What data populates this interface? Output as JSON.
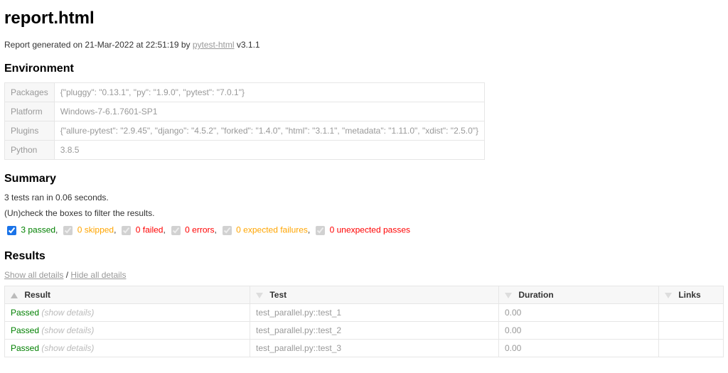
{
  "title": "report.html",
  "generated": {
    "prefix": "Report generated on ",
    "datetime": "21-Mar-2022 at 22:51:19",
    "by": " by ",
    "tool_link": "pytest-html",
    "version_suffix": " v3.1.1"
  },
  "environment": {
    "heading": "Environment",
    "rows": [
      {
        "key": "Packages",
        "value": "{\"pluggy\": \"0.13.1\", \"py\": \"1.9.0\", \"pytest\": \"7.0.1\"}"
      },
      {
        "key": "Platform",
        "value": "Windows-7-6.1.7601-SP1"
      },
      {
        "key": "Plugins",
        "value": "{\"allure-pytest\": \"2.9.45\", \"django\": \"4.5.2\", \"forked\": \"1.4.0\", \"html\": \"3.1.1\", \"metadata\": \"1.11.0\", \"xdist\": \"2.5.0\"}"
      },
      {
        "key": "Python",
        "value": "3.8.5"
      }
    ]
  },
  "summary": {
    "heading": "Summary",
    "ran_line": "3 tests ran in 0.06 seconds.",
    "filter_hint": "(Un)check the boxes to filter the results.",
    "filters": [
      {
        "label": "3 passed",
        "class": "passed",
        "checked": true,
        "disabled": false
      },
      {
        "label": "0 skipped",
        "class": "skipped",
        "checked": true,
        "disabled": true
      },
      {
        "label": "0 failed",
        "class": "failed",
        "checked": true,
        "disabled": true
      },
      {
        "label": "0 errors",
        "class": "error",
        "checked": true,
        "disabled": true
      },
      {
        "label": "0 expected failures",
        "class": "xfailed",
        "checked": true,
        "disabled": true
      },
      {
        "label": "0 unexpected passes",
        "class": "xpassed",
        "checked": true,
        "disabled": true
      }
    ],
    "comma": ","
  },
  "results": {
    "heading": "Results",
    "show_all": "Show all details",
    "sep": " / ",
    "hide_all": "Hide all details",
    "columns": [
      "Result",
      "Test",
      "Duration",
      "Links"
    ],
    "show_details_label": "(show details)",
    "rows": [
      {
        "result": "Passed",
        "test": "test_parallel.py::test_1",
        "duration": "0.00"
      },
      {
        "result": "Passed",
        "test": "test_parallel.py::test_2",
        "duration": "0.00"
      },
      {
        "result": "Passed",
        "test": "test_parallel.py::test_3",
        "duration": "0.00"
      }
    ]
  }
}
